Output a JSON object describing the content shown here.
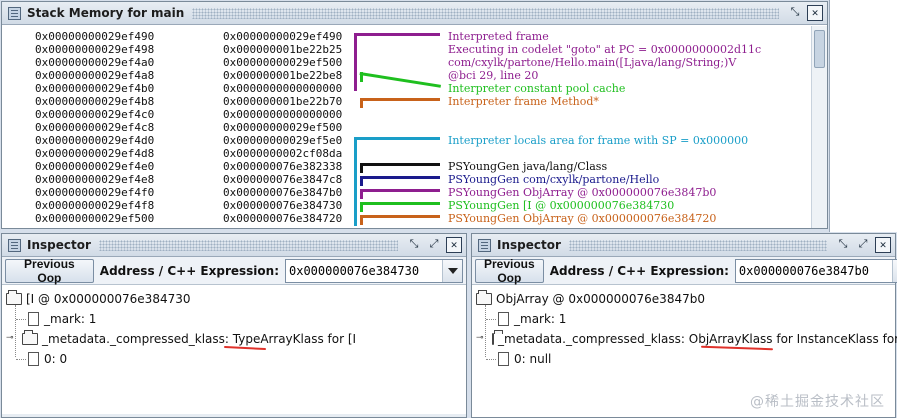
{
  "stack_panel": {
    "title": "Stack Memory for main",
    "rows": [
      {
        "addr": "0x00000000029ef490",
        "val": "0x00000000029ef490"
      },
      {
        "addr": "0x00000000029ef498",
        "val": "0x000000001be22b25"
      },
      {
        "addr": "0x00000000029ef4a0",
        "val": "0x00000000029ef500"
      },
      {
        "addr": "0x00000000029ef4a8",
        "val": "0x000000001be22be8"
      },
      {
        "addr": "0x00000000029ef4b0",
        "val": "0x0000000000000000"
      },
      {
        "addr": "0x00000000029ef4b8",
        "val": "0x000000001be22b70"
      },
      {
        "addr": "0x00000000029ef4c0",
        "val": "0x0000000000000000"
      },
      {
        "addr": "0x00000000029ef4c8",
        "val": "0x00000000029ef500"
      },
      {
        "addr": "0x00000000029ef4d0",
        "val": "0x00000000029ef5e0"
      },
      {
        "addr": "0x00000000029ef4d8",
        "val": "0x0000000002cf08da"
      },
      {
        "addr": "0x00000000029ef4e0",
        "val": "0x000000076e382338"
      },
      {
        "addr": "0x00000000029ef4e8",
        "val": "0x000000076e3847c8"
      },
      {
        "addr": "0x00000000029ef4f0",
        "val": "0x000000076e3847b0"
      },
      {
        "addr": "0x00000000029ef4f8",
        "val": "0x000000076e384730"
      },
      {
        "addr": "0x00000000029ef500",
        "val": "0x000000076e384720"
      }
    ],
    "annotations": [
      {
        "text": "Interpreted frame",
        "color": "#8e1e8f"
      },
      {
        "text": "Executing in codelet \"goto\" at PC = 0x0000000002d11c",
        "color": "#8e1e8f"
      },
      {
        "text": "com/cxylk/partone/Hello.main([Ljava/lang/String;)V",
        "color": "#8e1e8f"
      },
      {
        "text": "@bci 29, line 20",
        "color": "#8e1e8f"
      },
      {
        "text": "Interpreter constant pool cache",
        "color": "#1fbf1f"
      },
      {
        "text": "Interpreter frame Method*",
        "color": "#c8621a"
      },
      {
        "text": "Interpreter locals area for frame with SP = 0x000000",
        "color": "#1a9ec8"
      },
      {
        "text": "PSYoungGen java/lang/Class",
        "color": "#111111"
      },
      {
        "text": "PSYoungGen com/cxylk/partone/Hello",
        "color": "#1a1a8c"
      },
      {
        "text": "PSYoungGen ObjArray @ 0x000000076e3847b0",
        "color": "#8e1e8f"
      },
      {
        "text": "PSYoungGen [I @ 0x000000076e384730",
        "color": "#1fbf1f"
      },
      {
        "text": "PSYoungGen ObjArray @ 0x000000076e384720",
        "color": "#c8621a"
      }
    ]
  },
  "inspector_left": {
    "title": "Inspector",
    "prev_button": "Previous Oop",
    "expr_label": "Address / C++ Expression:",
    "expr_value": "0x000000076e384730",
    "tree": {
      "root": "[I @ 0x000000076e384730",
      "children": [
        "_mark: 1",
        "_metadata._compressed_klass: TypeArrayKlass for [I",
        "0: 0"
      ]
    }
  },
  "inspector_right": {
    "title": "Inspector",
    "prev_button": "Previous Oop",
    "expr_label": "Address / C++ Expression:",
    "expr_value": "0x000000076e3847b0",
    "tree": {
      "root": "ObjArray @ 0x000000076e3847b0",
      "children": [
        "_mark: 1",
        "_metadata._compressed_klass: ObjArrayKlass for InstanceKlass for",
        "0: null"
      ]
    }
  },
  "watermark": "@稀土掘金技术社区",
  "icons": {
    "restore": "restore-icon",
    "maximize": "maximize-icon",
    "close": "close-icon",
    "dropdown": "chevron-down-icon",
    "folder": "folder-icon",
    "file": "file-icon"
  },
  "colors": {
    "purple": "#8e1e8f",
    "green": "#1fbf1f",
    "orange": "#c8621a",
    "cyan": "#1a9ec8",
    "navy": "#1a1a8c",
    "highlight_underline": "#e0322b"
  }
}
